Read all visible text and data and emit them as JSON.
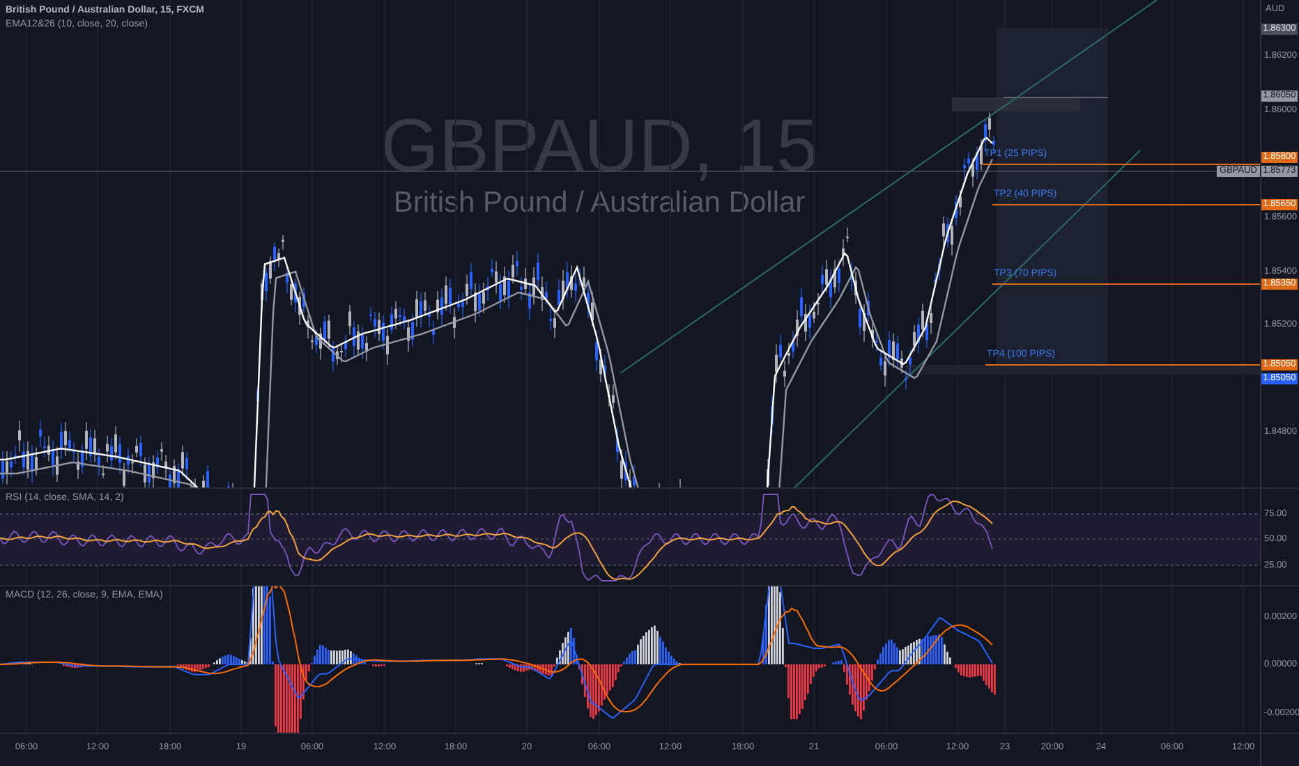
{
  "legend": {
    "title": "British Pound / Australian Dollar, 15, FXCM",
    "indicator": "EMA12&26 (10, close, 20, close)"
  },
  "watermark": {
    "symbol": "GBPAUD, 15",
    "description": "British Pound / Australian Dollar"
  },
  "price_axis": {
    "currency": "AUD",
    "labels": [
      "1.86200",
      "1.86000",
      "1.85600",
      "1.85400",
      "1.85200",
      "1.84800"
    ]
  },
  "price_tags": [
    {
      "kind": "high",
      "text": "1.86300"
    },
    {
      "kind": "last",
      "text": "1.86050"
    },
    {
      "kind": "target",
      "text": "1.85800"
    },
    {
      "kind": "symbol",
      "name": "GBPAUD",
      "text": "1.85773"
    },
    {
      "kind": "target",
      "text": "1.85650"
    },
    {
      "kind": "target",
      "text": "1.85350"
    },
    {
      "kind": "target",
      "text": "1.85050"
    },
    {
      "kind": "low",
      "text": "1.85050"
    }
  ],
  "targets": [
    {
      "label": "TP1 (25 PIPS)"
    },
    {
      "label": "TP2 (40 PIPS)"
    },
    {
      "label": "TP3 (70 PIPS)"
    },
    {
      "label": "TP4 (100 PIPS)"
    }
  ],
  "rsi": {
    "title": "RSI (14, close, SMA, 14, 2)",
    "axis": [
      "75.00",
      "50.00",
      "25.00"
    ]
  },
  "macd": {
    "title": "MACD (12, 26, close, 9, EMA, EMA)",
    "axis": [
      "0.00200",
      "0.00000",
      "-0.00200"
    ]
  },
  "time_axis": [
    "06:00",
    "12:00",
    "18:00",
    "19",
    "06:00",
    "12:00",
    "18:00",
    "20",
    "06:00",
    "12:00",
    "18:00",
    "21",
    "06:00",
    "12:00",
    "23",
    "20:00",
    "24",
    "06:00",
    "12:00"
  ]
}
